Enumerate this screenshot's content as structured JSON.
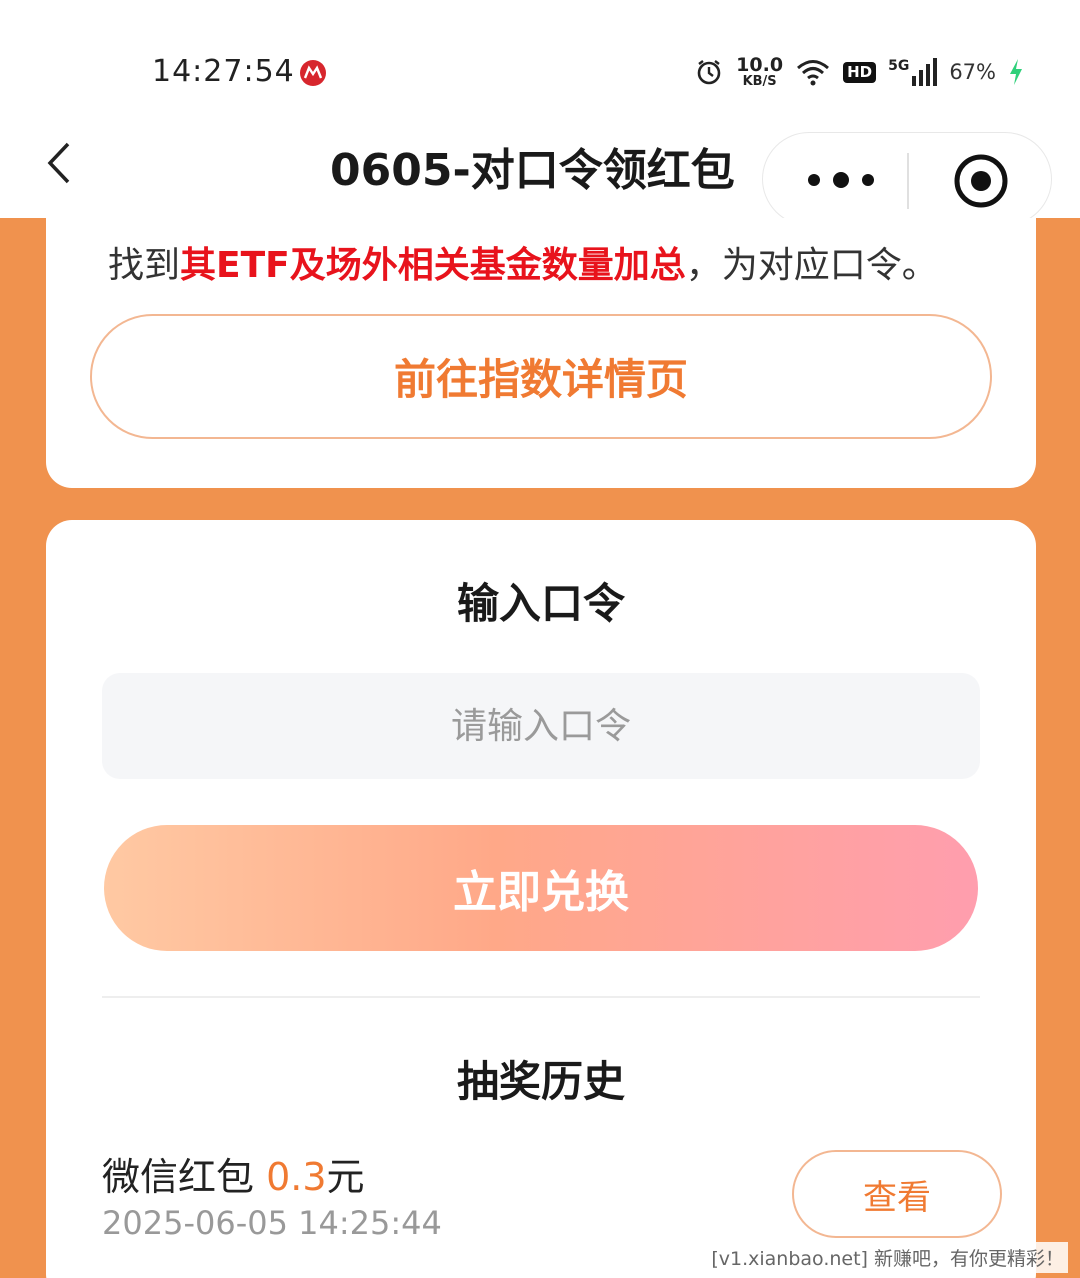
{
  "status_bar": {
    "time": "14:27:54",
    "net_speed_value": "10.0",
    "net_speed_unit": "KB/S",
    "hd_label": "HD",
    "network_label": "5G",
    "battery_percent": "67%",
    "icons": [
      "app-logo-icon",
      "alarm-icon",
      "wifi-icon",
      "signal-icon",
      "charging-icon"
    ]
  },
  "nav": {
    "title": "0605-对口令领红包"
  },
  "card_top": {
    "hint_prefix": "找到",
    "hint_highlight": "其ETF及场外相关基金数量加总",
    "hint_suffix": "，为对应口令。",
    "index_button_label": "前往指数详情页"
  },
  "redeem": {
    "title": "输入口令",
    "input_placeholder": "请输入口令",
    "input_value": "",
    "button_label": "立即兑换"
  },
  "history": {
    "title": "抽奖历史",
    "items": [
      {
        "prize_prefix": "微信红包",
        "prize_amount": "0.3",
        "prize_unit": "元",
        "time": "2025-06-05 14:25:44",
        "action_label": "查看"
      }
    ]
  },
  "watermark": "[v1.xianbao.net] 新赚吧，有你更精彩！",
  "colors": {
    "page_background": "#f0924e",
    "accent_orange": "#f07a32",
    "highlight_red": "#e8131c",
    "button_gradient_start": "#ffc9a3",
    "button_gradient_end": "#ff9eae"
  }
}
